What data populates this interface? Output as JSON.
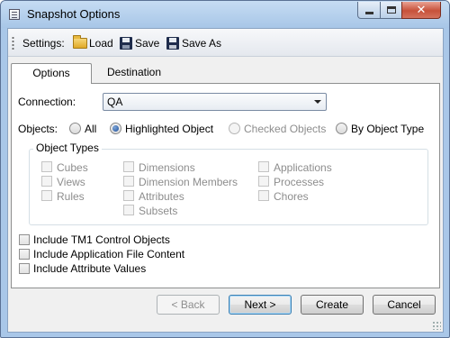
{
  "window": {
    "title": "Snapshot Options"
  },
  "toolbar": {
    "settings_label": "Settings:",
    "load_label": "Load",
    "save_label": "Save",
    "save_as_label": "Save As"
  },
  "tabs": [
    {
      "label": "Options",
      "selected": true
    },
    {
      "label": "Destination",
      "selected": false
    }
  ],
  "connection": {
    "label": "Connection:",
    "value": "QA"
  },
  "objects": {
    "label": "Objects:",
    "options": [
      {
        "label": "All",
        "checked": false,
        "enabled": true
      },
      {
        "label": "Highlighted Object",
        "checked": true,
        "enabled": true
      },
      {
        "label": "Checked Objects",
        "checked": false,
        "enabled": false
      },
      {
        "label": "By Object Type",
        "checked": false,
        "enabled": true
      }
    ]
  },
  "object_types": {
    "title": "Object Types",
    "items": [
      {
        "label": "Cubes",
        "checked": false,
        "enabled": false
      },
      {
        "label": "Views",
        "checked": false,
        "enabled": false
      },
      {
        "label": "Rules",
        "checked": false,
        "enabled": false
      },
      {
        "label": "Dimensions",
        "checked": false,
        "enabled": false
      },
      {
        "label": "Dimension Members",
        "checked": false,
        "enabled": false
      },
      {
        "label": "Attributes",
        "checked": false,
        "enabled": false
      },
      {
        "label": "Subsets",
        "checked": false,
        "enabled": false
      },
      {
        "label": "Applications",
        "checked": false,
        "enabled": false
      },
      {
        "label": "Processes",
        "checked": false,
        "enabled": false
      },
      {
        "label": "Chores",
        "checked": false,
        "enabled": false
      }
    ]
  },
  "include_options": [
    {
      "label": "Include TM1 Control Objects",
      "checked": false
    },
    {
      "label": "Include Application File Content",
      "checked": false
    },
    {
      "label": "Include Attribute Values",
      "checked": false
    }
  ],
  "buttons": {
    "back": "< Back",
    "next": "Next >",
    "create": "Create",
    "cancel": "Cancel"
  },
  "colors": {
    "frame": "#a9c7e8",
    "close_button": "#c7513a",
    "radio_dot": "#1d4f9a",
    "default_button_border": "#3c7fb1"
  }
}
